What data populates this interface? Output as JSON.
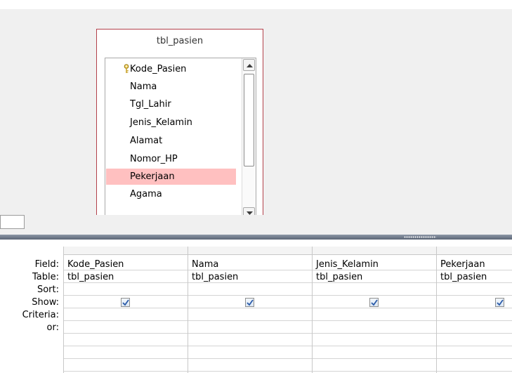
{
  "table": {
    "title": "tbl_pasien",
    "fields": [
      {
        "label": "Kode_Pasien",
        "is_key": true,
        "selected": false
      },
      {
        "label": "Nama",
        "is_key": false,
        "selected": false
      },
      {
        "label": "Tgl_Lahir",
        "is_key": false,
        "selected": false
      },
      {
        "label": "Jenis_Kelamin",
        "is_key": false,
        "selected": false
      },
      {
        "label": "Alamat",
        "is_key": false,
        "selected": false
      },
      {
        "label": "Nomor_HP",
        "is_key": false,
        "selected": false
      },
      {
        "label": "Pekerjaan",
        "is_key": false,
        "selected": true
      },
      {
        "label": "Agama",
        "is_key": false,
        "selected": false
      }
    ],
    "key_icon": "primary-key-icon",
    "selected_color": "#ffc0c0",
    "border_color": "#b3404a"
  },
  "grid": {
    "row_labels": {
      "field": "Field:",
      "table": "Table:",
      "sort": "Sort:",
      "show": "Show:",
      "criteria": "Criteria:",
      "or": "or:"
    },
    "columns": [
      {
        "field": "Kode_Pasien",
        "table": "tbl_pasien",
        "sort": "",
        "show": true,
        "criteria": "",
        "or": ""
      },
      {
        "field": "Nama",
        "table": "tbl_pasien",
        "sort": "",
        "show": true,
        "criteria": "",
        "or": ""
      },
      {
        "field": "Jenis_Kelamin",
        "table": "tbl_pasien",
        "sort": "",
        "show": true,
        "criteria": "",
        "or": ""
      },
      {
        "field": "Pekerjaan",
        "table": "tbl_pasien",
        "sort": "",
        "show": true,
        "criteria": "",
        "or": ""
      }
    ]
  }
}
